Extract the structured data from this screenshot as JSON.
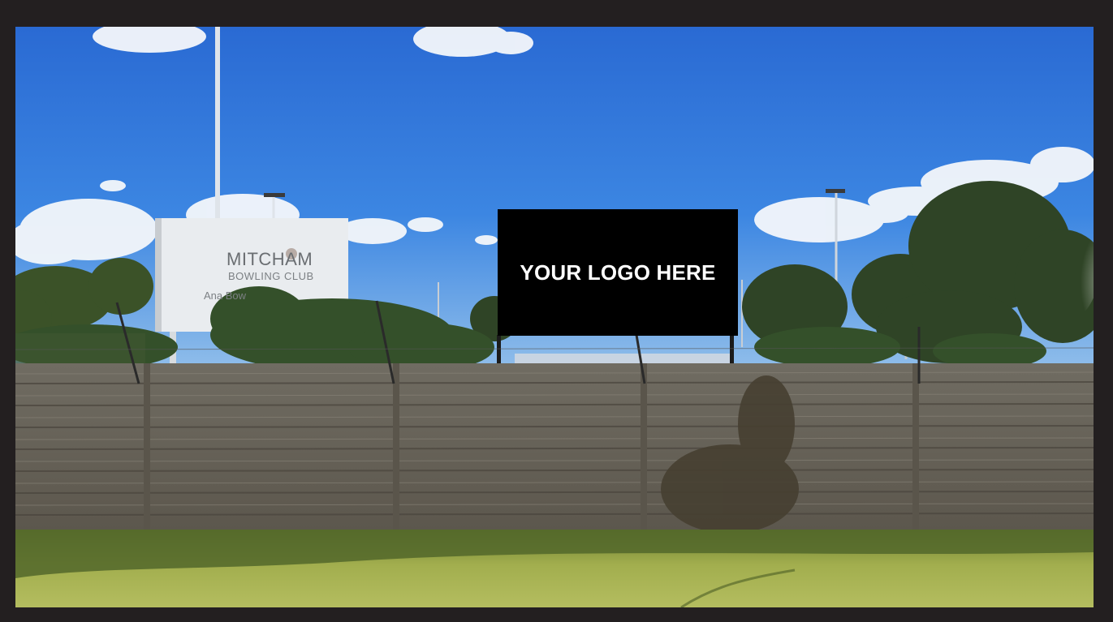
{
  "billboard": {
    "placeholder_text": "YOUR LOGO HERE",
    "background_color": "#000000",
    "text_color": "#ffffff"
  },
  "club_sign": {
    "name": "MITCHAM",
    "subtitle": "BOWLING CLUB",
    "line3": "Ana Bow"
  },
  "colors": {
    "frame": "#231f20",
    "sky": "#2f73d6",
    "fence": "#6e6a60",
    "grass": "#9aa84a"
  }
}
